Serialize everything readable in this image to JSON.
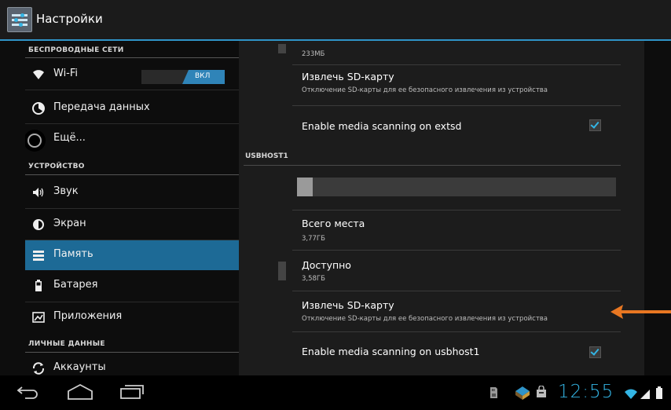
{
  "action_bar": {
    "title": "Настройки"
  },
  "sidebar": {
    "wireless_header": "БЕСПРОВОДНЫЕ СЕТИ",
    "device_header": "УСТРОЙСТВО",
    "personal_header": "ЛИЧНЫЕ ДАННЫЕ",
    "wifi": {
      "label": "Wi-Fi",
      "toggle": "ВКЛ"
    },
    "items": [
      {
        "label": "Передача данных"
      },
      {
        "label": "Ещё..."
      },
      {
        "label": "Звук"
      },
      {
        "label": "Экран"
      },
      {
        "label": "Память"
      },
      {
        "label": "Батарея"
      },
      {
        "label": "Приложения"
      },
      {
        "label": "Аккаунты"
      }
    ],
    "selected_item": "Память"
  },
  "storage": {
    "top_size": "233МБ",
    "extsd_unmount_title": "Извлечь SD-карту",
    "extsd_unmount_sub": "Отключение SD-карты для ее безопасного извлечения из устройства",
    "extsd_scanning": "Enable media scanning on extsd",
    "extsd_scanning_checked": true,
    "usbhost_header": "USBHOST1",
    "usage_fraction": 0.05,
    "total_title": "Всего места",
    "total_value": "3,77ГБ",
    "avail_title": "Доступно",
    "avail_value": "3,58ГБ",
    "usb_unmount_title": "Извлечь SD-карту",
    "usb_unmount_sub": "Отключение SD-карты для ее безопасного извлечения из устройства",
    "usb_scanning": "Enable media scanning on usbhost1",
    "usb_scanning_checked": true
  },
  "status_bar": {
    "clock": "12:55"
  },
  "colors": {
    "accent": "#33b5e5",
    "selected": "#1d6a96",
    "arrow": "#e87722"
  }
}
